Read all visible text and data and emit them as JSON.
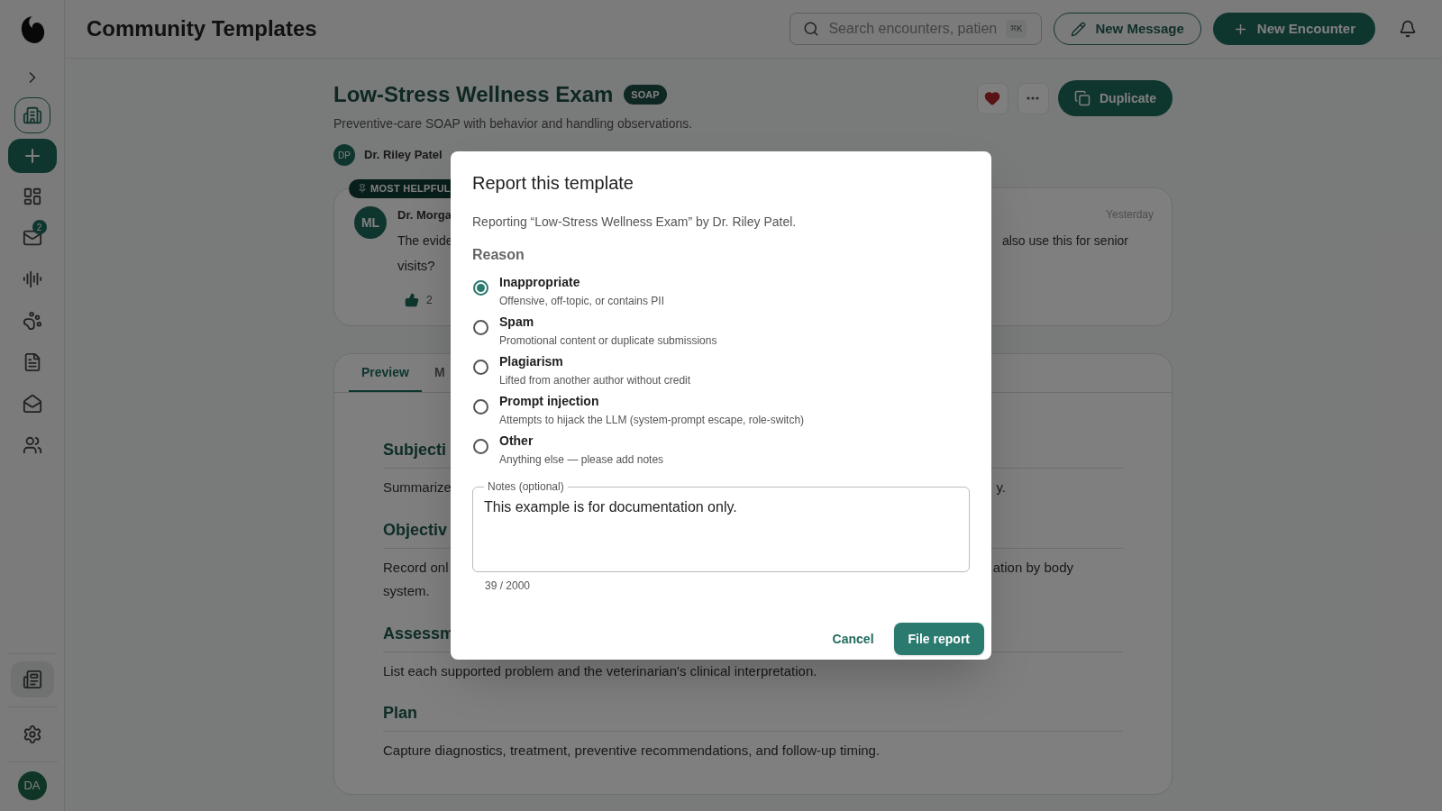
{
  "sidebar": {
    "nav": [
      {
        "kind": "building",
        "selected": false
      },
      {
        "kind": "add",
        "selected": false
      },
      {
        "kind": "dashboard",
        "selected": false
      },
      {
        "kind": "mail",
        "selected": false,
        "badge": "2"
      },
      {
        "kind": "audio",
        "selected": false
      },
      {
        "kind": "paw",
        "selected": false
      },
      {
        "kind": "file",
        "selected": false
      },
      {
        "kind": "mail-open",
        "selected": false
      },
      {
        "kind": "users",
        "selected": false
      }
    ],
    "bottom": [
      {
        "kind": "library",
        "selected": true
      },
      {
        "kind": "settings",
        "selected": false
      }
    ],
    "avatar": "DA"
  },
  "header": {
    "title": "Community Templates",
    "search": {
      "placeholder": "Search encounters, patien",
      "shortcut": "⌘K"
    },
    "buttons": [
      {
        "label": "New Message",
        "kind": "outline"
      },
      {
        "label": "New Encounter",
        "kind": "filled"
      }
    ]
  },
  "template": {
    "title": "Low-Stress Wellness Exam",
    "badge": "SOAP",
    "description": "Preventive-care SOAP with behavior and handling observations.",
    "favorited": true,
    "duplicate": "Duplicate",
    "author": {
      "initials": "DP",
      "name": "Dr. Riley Patel"
    }
  },
  "comment": {
    "pin": "MOST HELPFUL",
    "initials": "ML",
    "author": "Dr. Morga",
    "date": "Yesterday",
    "text_start": "The evide",
    "text_end": "also use this for senior",
    "text_line2": "visits?",
    "likes": "2"
  },
  "tabs": [
    {
      "label": "Preview",
      "selected": true
    },
    {
      "label": "M",
      "selected": false
    }
  ],
  "sections": [
    {
      "heading": "Subjecti",
      "lines": [
        {
          "start": "Summarize",
          "end": "y."
        }
      ]
    },
    {
      "heading": "Objectiv",
      "lines": [
        {
          "start": "Record onl",
          "end": "ation by body"
        },
        {
          "start": "system."
        }
      ]
    },
    {
      "heading": "Assessm",
      "lines": [
        {
          "start": "List each supported problem and the veterinarian's clinical interpretation."
        }
      ]
    },
    {
      "heading": "Plan",
      "lines": [
        {
          "start": "Capture diagnostics, treatment, preventive recommendations, and follow-up timing."
        }
      ]
    }
  ],
  "dialog": {
    "title": "Report this template",
    "subtitle": "Reporting “Low-Stress Wellness Exam” by Dr. Riley Patel.",
    "reason_label": "Reason",
    "reasons": [
      {
        "label": "Inappropriate",
        "hint": "Offensive, off-topic, or contains PII",
        "selected": true
      },
      {
        "label": "Spam",
        "hint": "Promotional content or duplicate submissions",
        "selected": false
      },
      {
        "label": "Plagiarism",
        "hint": "Lifted from another author without credit",
        "selected": false
      },
      {
        "label": "Prompt injection",
        "hint": "Attempts to hijack the LLM (system-prompt escape, role-switch)",
        "selected": false
      },
      {
        "label": "Other",
        "hint": "Anything else — please add notes",
        "selected": false
      }
    ],
    "notes": {
      "label": "Notes (optional)",
      "value": "This example is for documentation only.",
      "counter": "39 / 2000"
    },
    "cancel": "Cancel",
    "submit": "File report"
  }
}
